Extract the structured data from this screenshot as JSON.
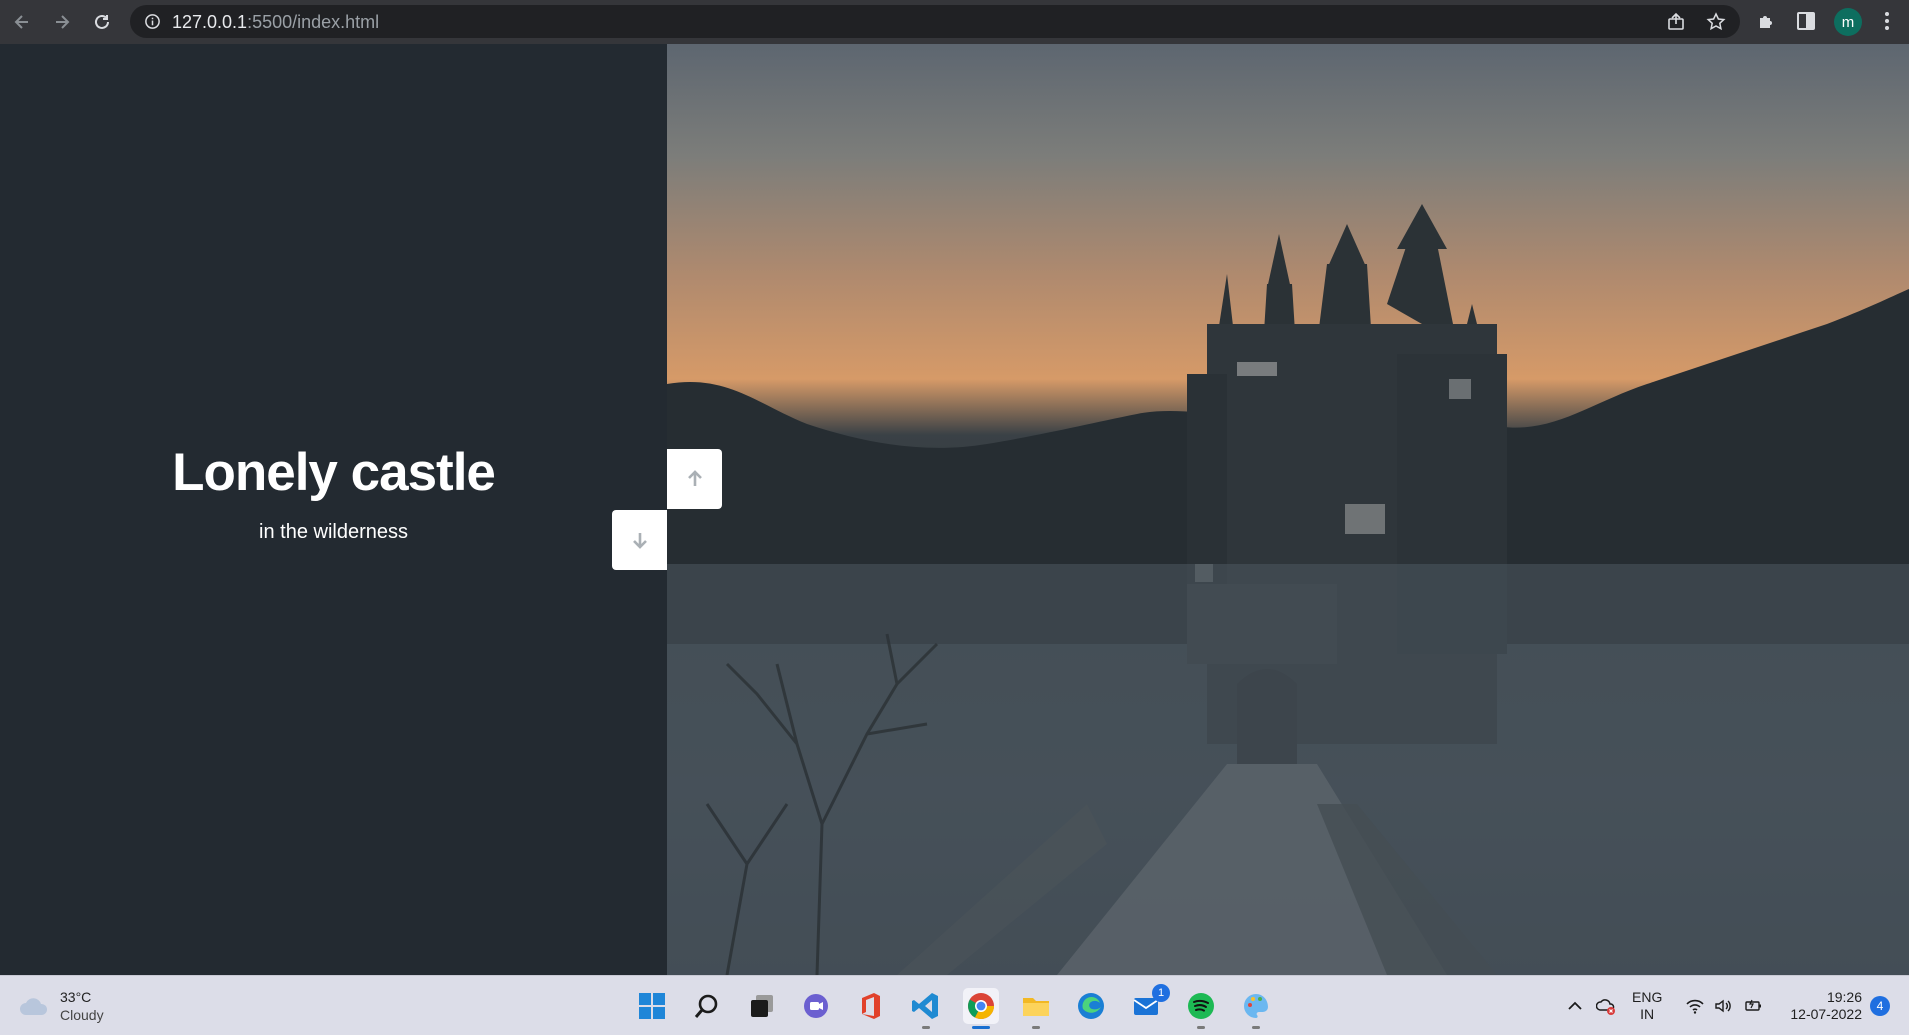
{
  "browser": {
    "url_host": "127.0.0.1",
    "url_path": ":5500/index.html",
    "profile_initial": "m"
  },
  "page": {
    "title": "Lonely castle",
    "subtitle": "in the wilderness"
  },
  "taskbar": {
    "weather_temp": "33°C",
    "weather_desc": "Cloudy",
    "mail_badge": "1",
    "lang_primary": "ENG",
    "lang_secondary": "IN",
    "time": "19:26",
    "date": "12-07-2022",
    "notification_count": "4"
  },
  "colors": {
    "left_panel_bg": "#232a31",
    "accent_blue": "#1f6fe0"
  }
}
